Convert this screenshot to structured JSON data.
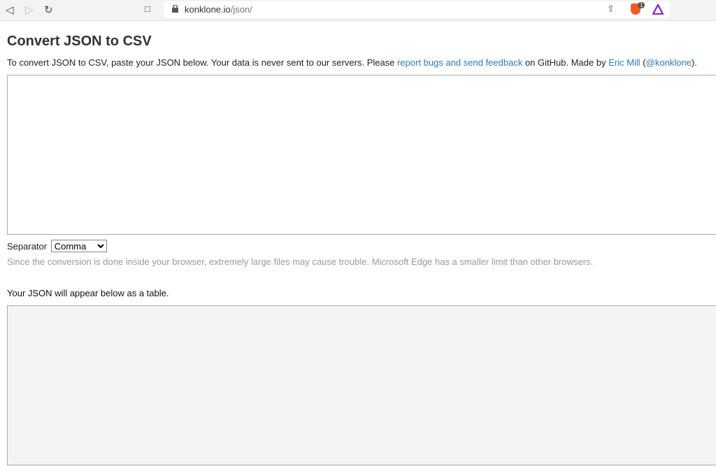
{
  "browser": {
    "url_host": "konklone.io",
    "url_path": "/json/",
    "brave_badge": "1"
  },
  "page": {
    "title": "Convert JSON to CSV",
    "intro_before": "To convert JSON to CSV, paste your JSON below. Your data is never sent to our servers. Please ",
    "link_feedback": "report bugs and send feedback",
    "intro_mid": " on GitHub. Made by ",
    "link_author": "Eric Mill",
    "paren_open": " (",
    "link_handle": "@konklone",
    "paren_close": ").",
    "json_input_value": "",
    "separator_label": "Separator",
    "separator_value": "Comma",
    "note": "Since the conversion is done inside your browser, extremely large files may cause trouble. Microsoft Edge has a smaller limit than other browsers.",
    "table_heading": "Your JSON will appear below as a table."
  }
}
